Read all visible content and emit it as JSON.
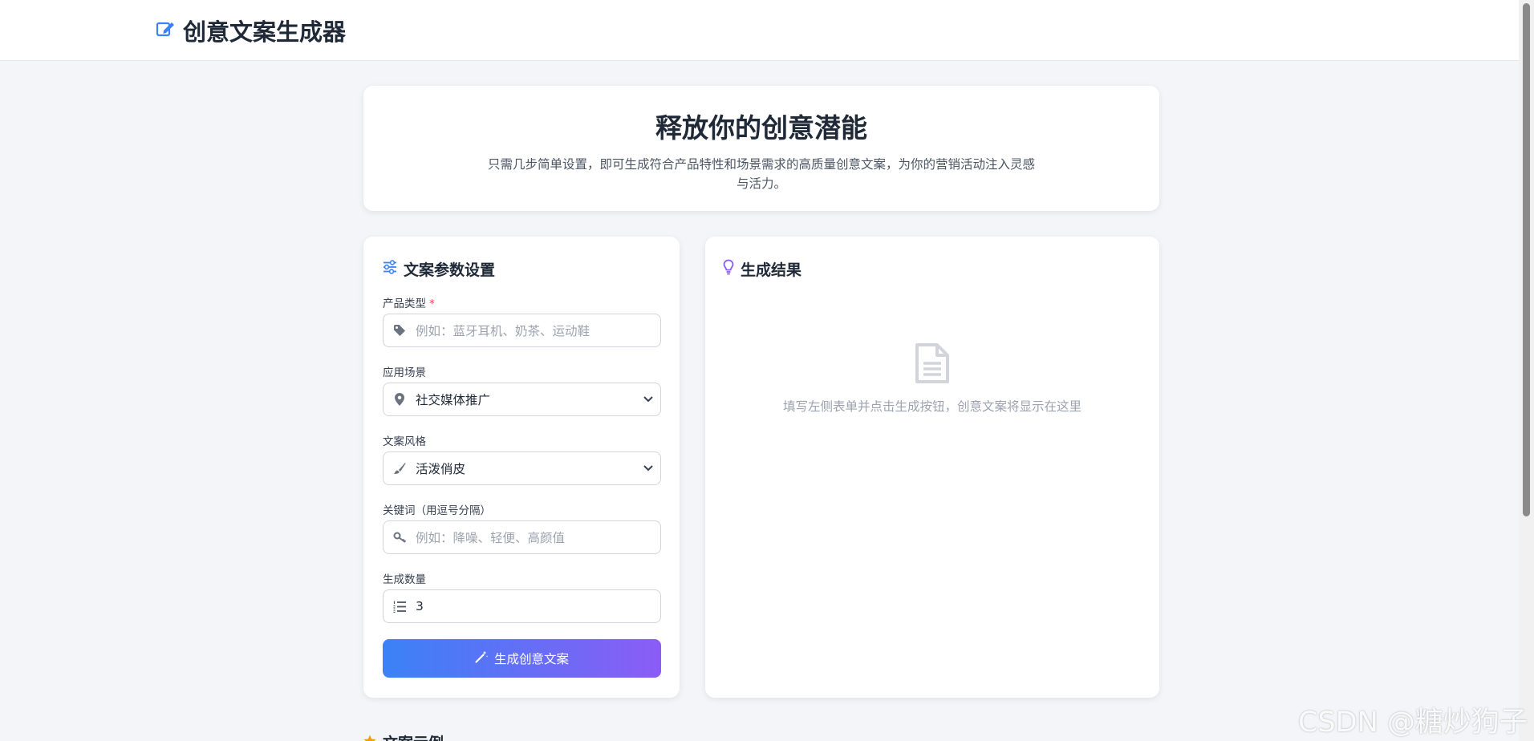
{
  "header": {
    "title": "创意文案生成器"
  },
  "hero": {
    "title": "释放你的创意潜能",
    "description": "只需几步简单设置，即可生成符合产品特性和场景需求的高质量创意文案，为你的营销活动注入灵感与活力。"
  },
  "form": {
    "title": "文案参数设置",
    "product": {
      "label": "产品类型",
      "required_mark": "*",
      "placeholder": "例如：蓝牙耳机、奶茶、运动鞋"
    },
    "scene": {
      "label": "应用场景",
      "value": "社交媒体推广"
    },
    "style": {
      "label": "文案风格",
      "value": "活泼俏皮"
    },
    "keywords": {
      "label": "关键词（用逗号分隔）",
      "placeholder": "例如：降噪、轻便、高颜值"
    },
    "count": {
      "label": "生成数量",
      "value": "3"
    },
    "submit_label": "生成创意文案"
  },
  "result": {
    "title": "生成结果",
    "empty_text": "填写左侧表单并点击生成按钮，创意文案将显示在这里"
  },
  "below": {
    "title": "文案示例"
  },
  "watermark": "CSDN @糖炒狗子",
  "colors": {
    "accent": "#3b82f6",
    "gradient_end": "#8b5cf6",
    "required": "#ef4444"
  }
}
